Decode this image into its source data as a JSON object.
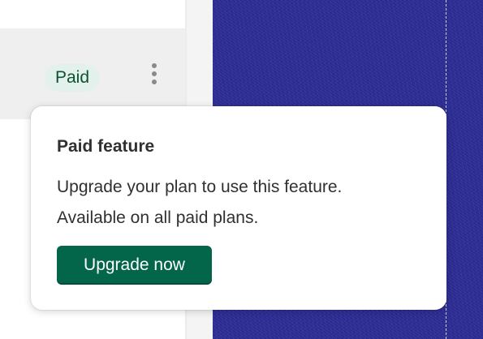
{
  "row": {
    "status_badge": "Paid",
    "more_actions_icon": "kebab-vertical-icon"
  },
  "popover": {
    "title": "Paid feature",
    "body_line_1": "Upgrade your plan to use this feature.",
    "body_line_2": "Available on all paid plans.",
    "upgrade_button_label": "Upgrade now"
  },
  "colors": {
    "badge_bg": "#e3f1ec",
    "badge_text": "#0c5132",
    "primary_button": "#03664a",
    "canvas_blue": "#2b2b94"
  }
}
